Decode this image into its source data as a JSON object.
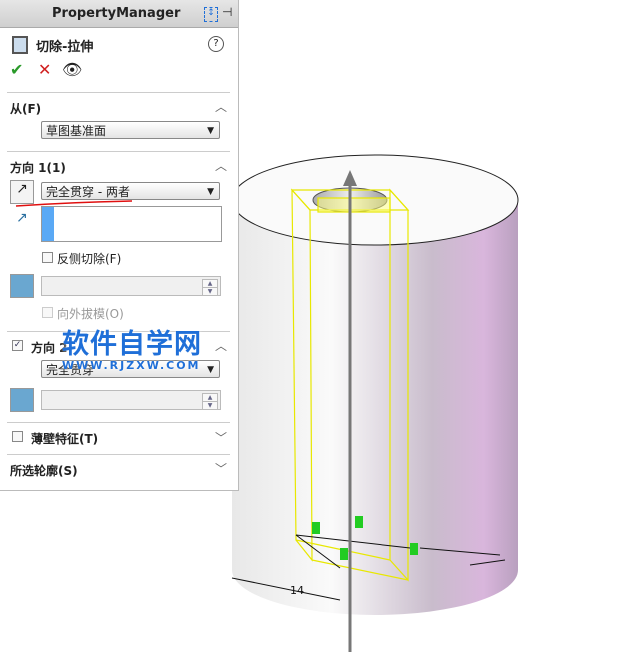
{
  "panel": {
    "title": "PropertyManager",
    "feature_name": "切除-拉伸",
    "help": "?",
    "from": {
      "label": "从(F)",
      "value": "草图基准面"
    },
    "dir1": {
      "label": "方向 1(1)",
      "end_condition": "完全贯穿 - 两者",
      "flip_side_cut": "反侧切除(F)",
      "draft_outward": "向外拔模(O)"
    },
    "dir2": {
      "label": "方向 2",
      "checked": true,
      "end_condition": "完全贯穿"
    },
    "thin": {
      "label": "薄壁特征(T)"
    },
    "contours": {
      "label": "所选轮廓(S)"
    }
  },
  "watermark": {
    "title": "软件自学网",
    "url": "WWW.RJZXW.COM"
  },
  "dimension": {
    "value": "14"
  },
  "colors": {
    "accent": "#1f6fd8",
    "sketch": "#ffff00",
    "ok": "#2a9a2a",
    "cancel": "#d02020"
  }
}
